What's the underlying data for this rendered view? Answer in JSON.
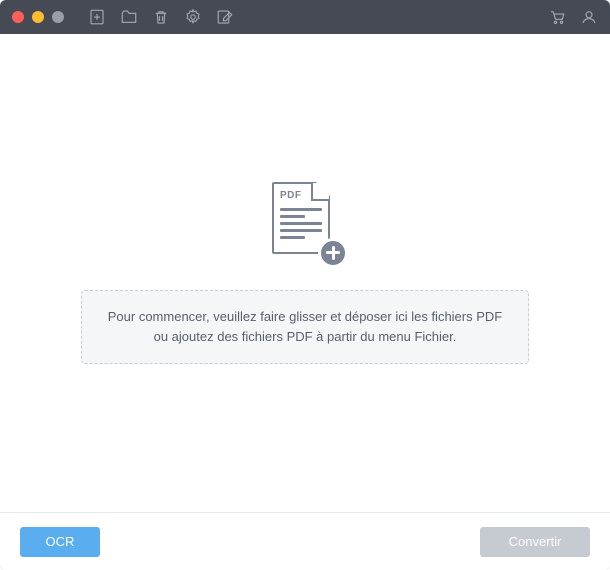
{
  "toolbar": {
    "traffic": {
      "close": "close",
      "min": "minimize",
      "max": "zoom"
    }
  },
  "illustration": {
    "pdf_label": "PDF"
  },
  "hint": {
    "line1": "Pour commencer, veuillez faire glisser et déposer ici les fichiers PDF",
    "line2": "ou ajoutez des fichiers PDF à partir du menu Fichier."
  },
  "footer": {
    "ocr_label": "OCR",
    "convert_label": "Convertir"
  }
}
